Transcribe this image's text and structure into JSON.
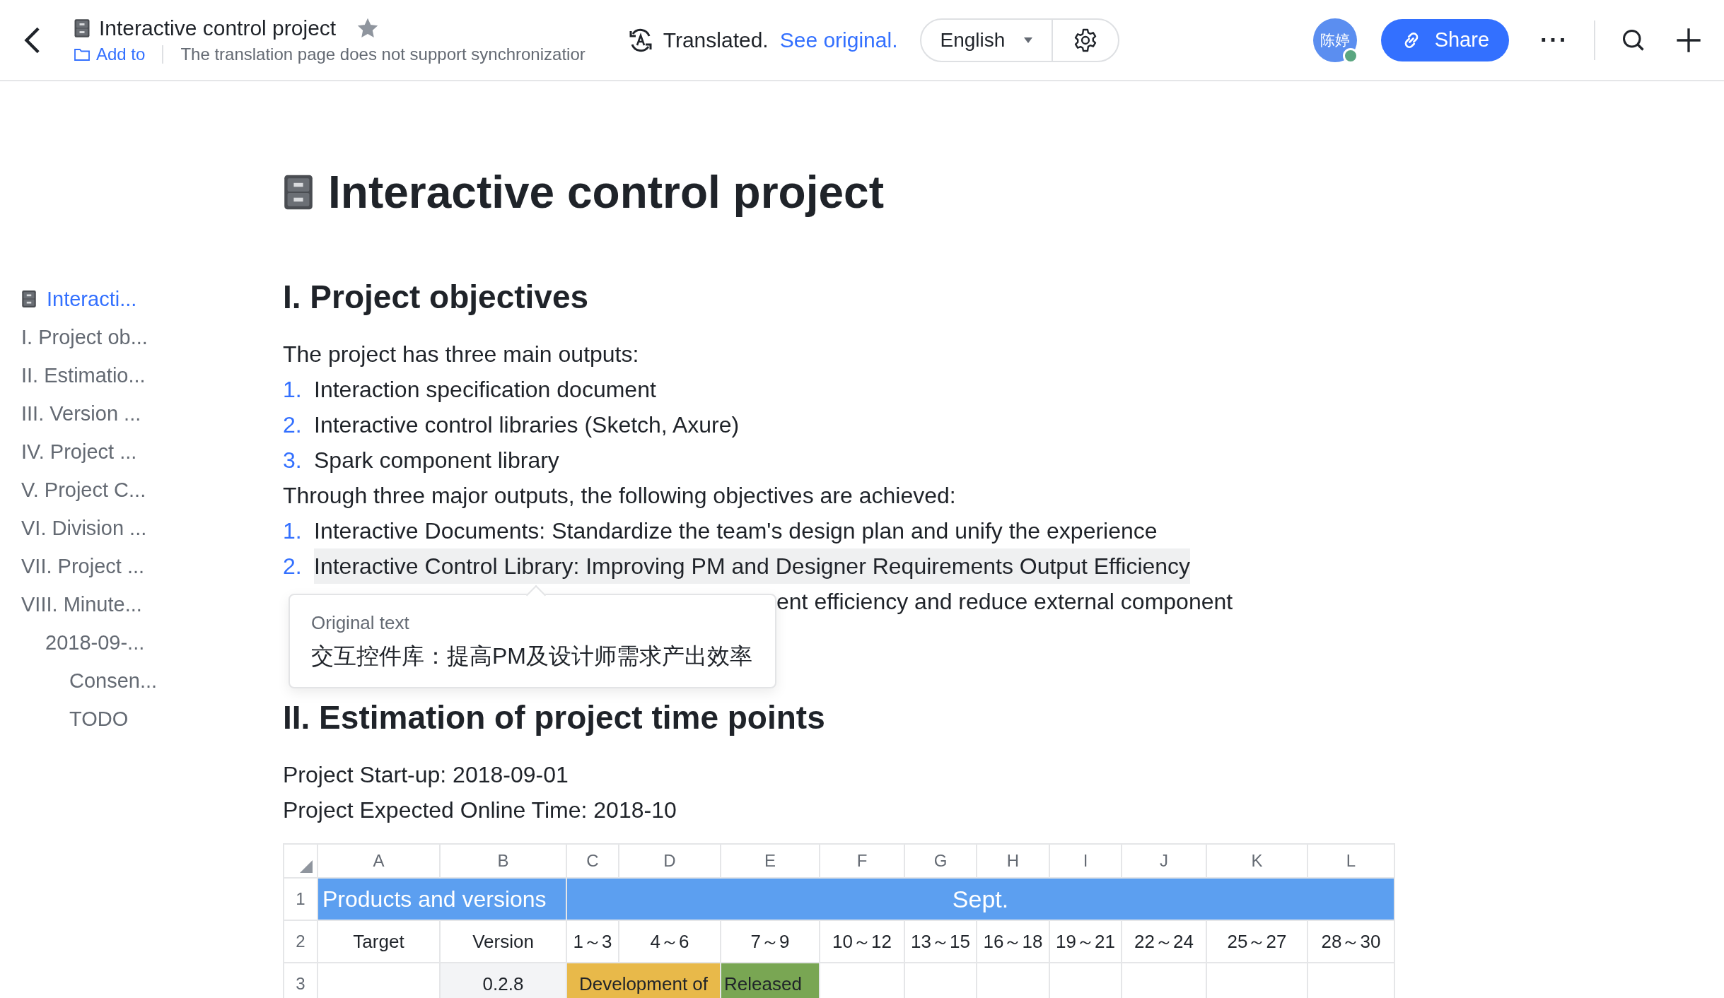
{
  "header": {
    "title": "Interactive control project",
    "starred": true,
    "add_to": "Add to",
    "sync_note": "The translation page does not support synchronizatior",
    "translated": "Translated.",
    "see_original": "See original.",
    "language": "English",
    "avatar": "陈婷",
    "online": true,
    "share": "Share",
    "more": "···"
  },
  "outline": [
    {
      "label": "Interacti...",
      "selected": true,
      "icon": true
    },
    {
      "label": "I. Project ob...",
      "selected": false
    },
    {
      "label": "II. Estimatio...",
      "selected": false
    },
    {
      "label": "III. Version ...",
      "selected": false
    },
    {
      "label": "IV. Project ...",
      "selected": false
    },
    {
      "label": "V. Project C...",
      "selected": false
    },
    {
      "label": "VI. Division ...",
      "selected": false
    },
    {
      "label": "VII. Project ...",
      "selected": false
    },
    {
      "label": "VIII. Minute...",
      "selected": false,
      "children": [
        {
          "label": "2018-09-...",
          "selected": false,
          "children": [
            {
              "label": "Consen...",
              "selected": false
            },
            {
              "label": "TODO",
              "selected": false
            }
          ]
        }
      ]
    }
  ],
  "document": {
    "title": "Interactive control project",
    "blocks": [
      {
        "kind": "heading",
        "text": "I. Project objectives"
      },
      {
        "kind": "paragraph",
        "text": "The project has three main outputs:"
      },
      {
        "kind": "item",
        "number": "1.",
        "text": "Interaction specification document",
        "highlighted": false
      },
      {
        "kind": "item",
        "number": "2.",
        "text": "Interactive control libraries (Sketch, Axure)",
        "highlighted": false
      },
      {
        "kind": "item",
        "number": "3.",
        "text": "Spark component library",
        "highlighted": false
      },
      {
        "kind": "paragraph",
        "text": "Through three major outputs, the following objectives are achieved:"
      },
      {
        "kind": "item",
        "number": "1.",
        "text": "Interactive Documents: Standardize the team's design plan and unify the experience",
        "highlighted": false
      },
      {
        "kind": "item",
        "number": "2.",
        "text": "Interactive Control Library: Improving PM and Designer Requirements Output Efficiency",
        "highlighted": true,
        "tooltip": {
          "label": "Original text",
          "text": "交互控件库：提高PM及设计师需求产出效率"
        }
      },
      {
        "kind": "covered",
        "text": "ent efficiency and reduce external component"
      },
      {
        "kind": "spacer"
      },
      {
        "kind": "heading",
        "text": "II. Estimation of project time points"
      },
      {
        "kind": "paragraph",
        "text": "Project Start-up: 2018-09-01"
      },
      {
        "kind": "paragraph",
        "text": "Project Expected Online Time: 2018-10"
      }
    ],
    "sheet": {
      "columns": [
        "A",
        "B",
        "C",
        "D",
        "E",
        "F",
        "G",
        "H",
        "I",
        "J",
        "K",
        "L"
      ],
      "rows": [
        {
          "number": "1",
          "cells": [
            {
              "text": "Products and versions",
              "color": "#5c9ff0",
              "kind": "band"
            },
            {
              "kind": "merged"
            },
            {
              "text": "Sept.",
              "color": "#5c9ff0",
              "kind": "band-center"
            },
            {
              "kind": "merged"
            },
            {
              "kind": "merged"
            },
            {
              "kind": "merged"
            },
            {
              "kind": "merged"
            },
            {
              "kind": "merged"
            },
            {
              "kind": "merged"
            },
            {
              "kind": "merged"
            },
            {
              "kind": "merged"
            },
            {
              "kind": "merged"
            }
          ]
        },
        {
          "number": "2",
          "cells": [
            {
              "text": "Target"
            },
            {
              "text": "Version"
            },
            {
              "text": "1～3"
            },
            {
              "text": "4～6"
            },
            {
              "text": "7～9"
            },
            {
              "text": "10～12"
            },
            {
              "text": "13～15"
            },
            {
              "text": "16～18"
            },
            {
              "text": "19～21"
            },
            {
              "text": "22～24"
            },
            {
              "text": "25～27"
            },
            {
              "text": "28～30"
            }
          ]
        },
        {
          "number": "3",
          "cells": [
            {},
            {
              "text": "0.2.8",
              "color": "#f3f4f6"
            },
            {
              "text": "Development of",
              "color": "#e8b94a"
            },
            {
              "kind": "merged"
            },
            {
              "text": "Released",
              "color": "#79a653",
              "kind": "left"
            },
            {},
            {},
            {},
            {},
            {},
            {},
            {}
          ]
        }
      ]
    }
  }
}
